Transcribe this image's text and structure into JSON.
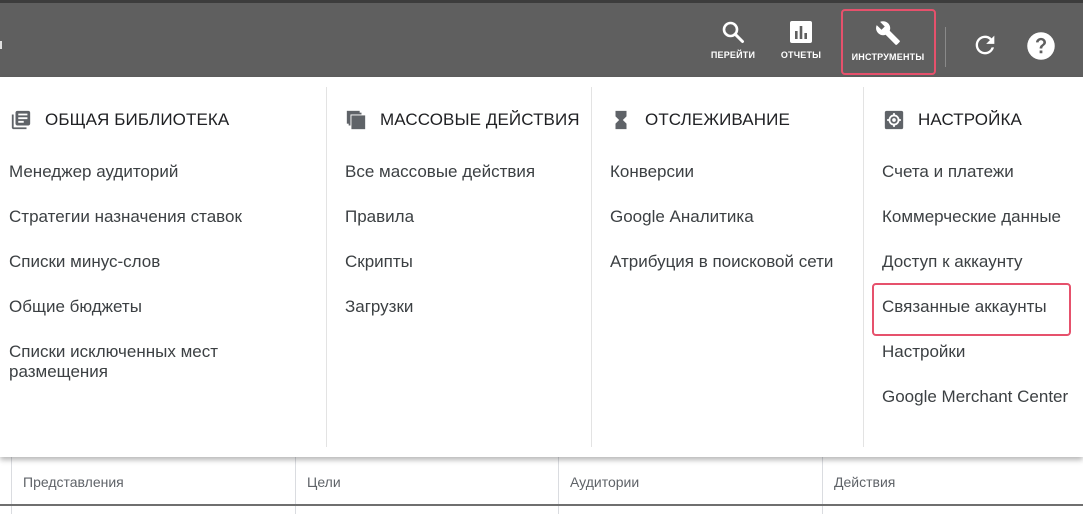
{
  "toolbar": {
    "go_label": "ПЕРЕЙТИ",
    "reports_label": "ОТЧЕТЫ",
    "tools_label": "ИНСТРУМЕНТЫ",
    "refresh_icon": "refresh-icon",
    "help_icon": "help-icon",
    "highlight_color": "#e6516c",
    "bar_color": "#5f5f5f"
  },
  "menu": {
    "shared_library": {
      "title": "ОБЩАЯ БИБЛИОТЕКА",
      "icon": "library-icon",
      "items": [
        "Менеджер аудиторий",
        "Стратегии назначения ставок",
        "Списки минус-слов",
        "Общие бюджеты",
        "Списки исключенных мест размещения"
      ]
    },
    "bulk_actions": {
      "title": "МАССОВЫЕ ДЕЙСТВИЯ",
      "icon": "copy-icon",
      "items": [
        "Все массовые действия",
        "Правила",
        "Скрипты",
        "Загрузки"
      ]
    },
    "tracking": {
      "title": "ОТСЛЕЖИВАНИЕ",
      "icon": "hourglass-icon",
      "items": [
        "Конверсии",
        "Google Аналитика",
        "Атрибуция в поисковой сети"
      ]
    },
    "settings": {
      "title": "НАСТРОЙКА",
      "icon": "gear-icon",
      "items": [
        "Счета и платежи",
        "Коммерческие данные",
        "Доступ к аккаунту",
        "Связанные аккаунты",
        "Настройки",
        "Google Merchant Center"
      ]
    }
  },
  "table": {
    "columns": [
      "Представления",
      "Цели",
      "Аудитории",
      "Действия"
    ]
  }
}
